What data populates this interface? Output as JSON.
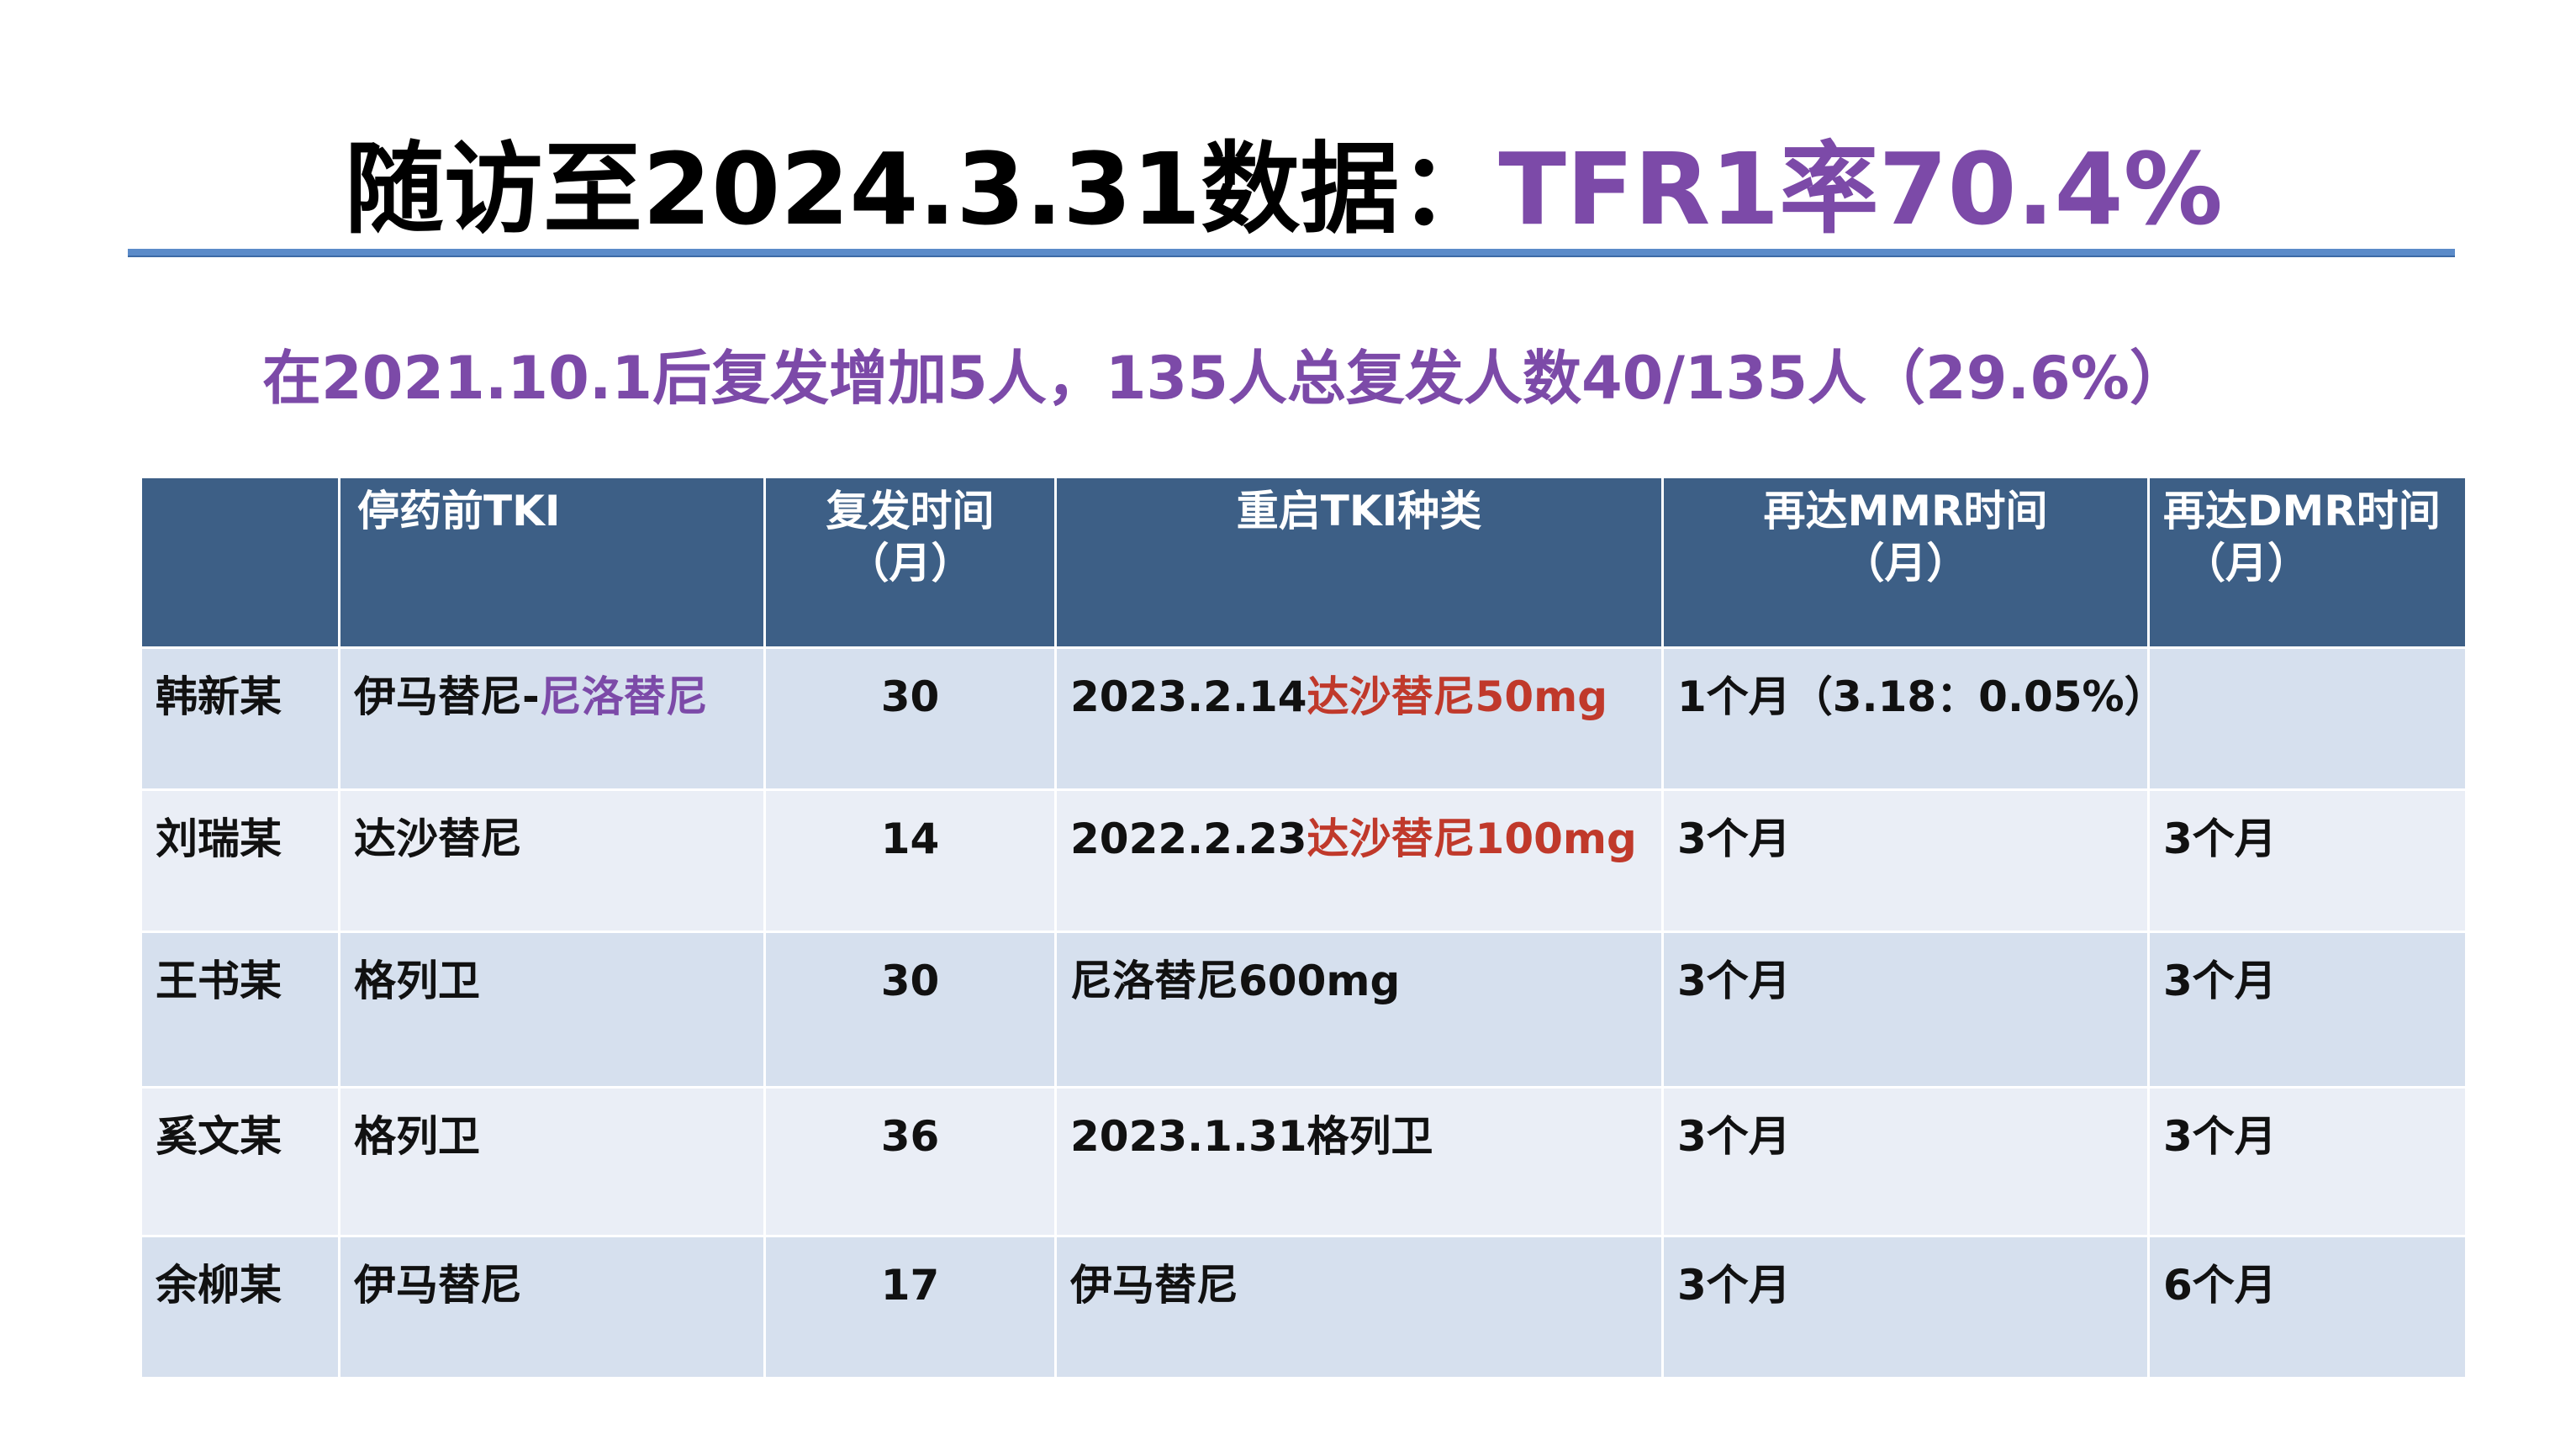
{
  "title": {
    "prefix": "随访至2024.3.31数据：",
    "highlight": "TFR1率70.4%"
  },
  "subtitle": "在2021.10.1后复发增加5人，135人总复发人数40/135人（29.6%）",
  "colors": {
    "header_bg": "#3d5f86",
    "row_odd": "#d6e0ee",
    "row_even": "#eaeef6",
    "accent_purple": "#7c4aa8",
    "accent_red": "#c0392b",
    "rule": "#5b8bc9"
  },
  "table": {
    "headers": [
      {
        "line1": "",
        "line2": ""
      },
      {
        "line1": "停药前TKI",
        "line2": ""
      },
      {
        "line1": "复发时间",
        "line2": "（月）"
      },
      {
        "line1": "重启TKI种类",
        "line2": ""
      },
      {
        "line1": "再达MMR时间",
        "line2": "（月）"
      },
      {
        "line1": "再达DMR时间",
        "line2": "（月）"
      }
    ],
    "rows": [
      {
        "name": "韩新某",
        "prior_tki_a": "伊马替尼",
        "prior_tki_sep": "-",
        "prior_tki_b": "尼洛替尼",
        "relapse": "30",
        "restart_date": "2023.2.14",
        "restart_drug": "达沙替尼50mg",
        "mmr": "1个月（3.18：0.05%）",
        "dmr": ""
      },
      {
        "name": "刘瑞某",
        "prior_tki": "达沙替尼",
        "relapse": "14",
        "restart_date": "2022.2.23",
        "restart_drug": "达沙替尼100mg",
        "mmr": "3个月",
        "dmr": "3个月"
      },
      {
        "name": "王书某",
        "prior_tki": "格列卫",
        "relapse": "30",
        "restart_drug": "尼洛替尼600mg",
        "mmr": "3个月",
        "dmr": "3个月"
      },
      {
        "name": "奚文某",
        "prior_tki": "格列卫",
        "relapse": "36",
        "restart": "2023.1.31格列卫",
        "mmr": "3个月",
        "dmr": "3个月"
      },
      {
        "name": "余柳某",
        "prior_tki": "伊马替尼",
        "relapse": "17",
        "restart": "伊马替尼",
        "mmr": "3个月",
        "dmr": "6个月"
      }
    ]
  }
}
